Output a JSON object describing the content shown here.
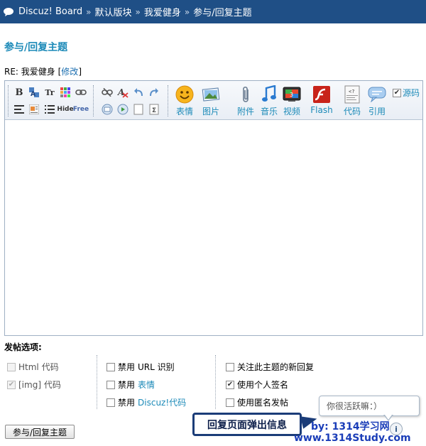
{
  "breadcrumb": {
    "items": [
      "Discuz! Board",
      "默认版块",
      "我爱健身",
      "参与/回复主题"
    ],
    "separator": "»"
  },
  "page_title": "参与/回复主题",
  "subject": {
    "text": "RE: 我爱健身",
    "bracket_open": "[",
    "edit_link": "修改",
    "bracket_close": "]"
  },
  "toolbar": {
    "small_icons": [
      "bold-icon",
      "font-color-icon",
      "font-size-icon",
      "background-color-icon",
      "link-icon",
      "unlink-icon",
      "remove-format-icon",
      "undo-icon",
      "redo-icon",
      "align-icon",
      "float-icon",
      "list-icon",
      "hide-icon",
      "free-icon",
      "insert-image-icon",
      "insert-media-icon",
      "page-break-icon",
      "sum-icon"
    ],
    "small_texts": {
      "bold": "B",
      "size": "Tr",
      "hide": "Hide",
      "free": "Free"
    },
    "big_buttons": [
      {
        "label": "表情",
        "icon": "smiley-icon"
      },
      {
        "label": "图片",
        "icon": "picture-icon"
      },
      {
        "label": "附件",
        "icon": "paperclip-icon"
      },
      {
        "label": "音乐",
        "icon": "music-note-icon"
      },
      {
        "label": "视频",
        "icon": "video-icon"
      },
      {
        "label": "Flash",
        "icon": "flash-icon"
      },
      {
        "label": "代码",
        "icon": "code-icon"
      },
      {
        "label": "引用",
        "icon": "quote-icon"
      }
    ],
    "source_label": "源码",
    "source_checked": true
  },
  "options": {
    "heading": "发帖选项:",
    "col1": [
      {
        "label": "Html 代码",
        "checked": false,
        "disabled": true
      },
      {
        "label": "[img] 代码",
        "checked": true,
        "disabled": true
      }
    ],
    "col2": [
      {
        "prefix": "禁用",
        "label": "URL 识别",
        "checked": false,
        "blue": false
      },
      {
        "prefix": "禁用",
        "label": "表情",
        "checked": false,
        "blue": true
      },
      {
        "prefix": "禁用",
        "label": "Discuz!代码",
        "checked": false,
        "blue": true
      }
    ],
    "col3": [
      {
        "label": "关注此主题的新回复",
        "checked": false
      },
      {
        "label": "使用个人签名",
        "checked": true
      },
      {
        "label": "使用匿名发帖",
        "checked": false
      }
    ]
  },
  "submit_label": "参与/回复主题",
  "tooltip_text": "你很活跃嘛：）",
  "info_icon_glyph": "i",
  "callout_text": "回复页面弹出信息",
  "watermark": {
    "line1": "by:  1314学习网",
    "line2": "www.1314Study.com"
  },
  "colors": {
    "header_bg": "#1f4f86",
    "accent_blue": "#1c8ab8",
    "callout_border": "#1b3c78"
  }
}
